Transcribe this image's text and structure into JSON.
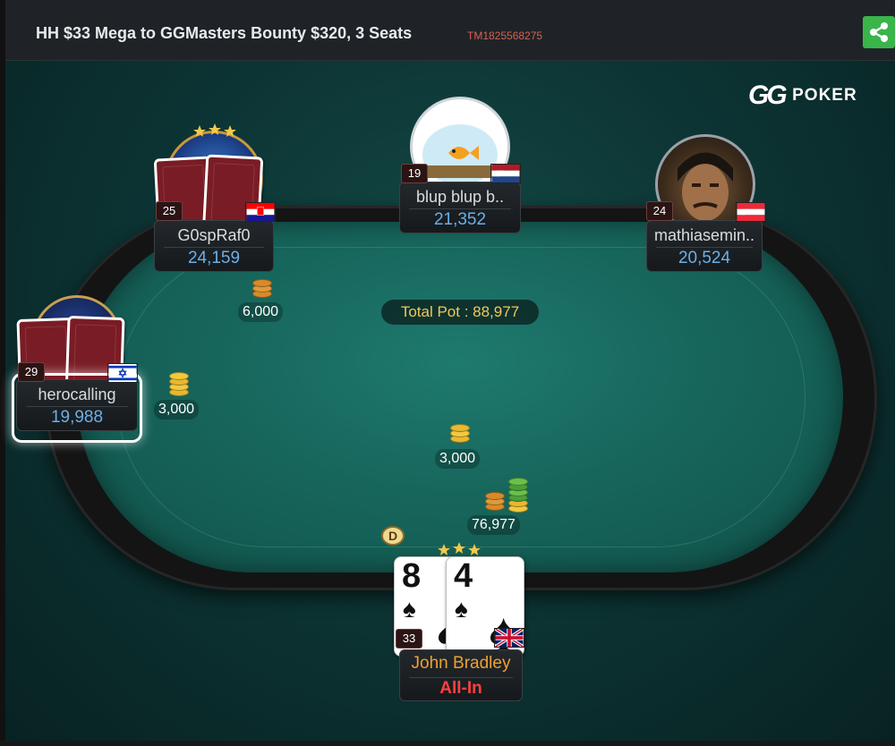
{
  "header": {
    "title": "HH $33 Mega to GGMasters Bounty $320, 3 Seats",
    "tournament_id": "TM1825568275",
    "share_icon": "share-icon"
  },
  "logo": {
    "gg": "GG",
    "poker": "POKER"
  },
  "pot": {
    "label": "Total Pot : 88,977"
  },
  "players": {
    "g0sp": {
      "name": "G0spRaf0",
      "stack": "24,159",
      "level": "25",
      "flag": "croatia",
      "bet": "6,000"
    },
    "blup": {
      "name": "blup blup b..",
      "stack": "21,352",
      "level": "19",
      "flag": "netherlands"
    },
    "mathia": {
      "name": "mathiasemin..",
      "stack": "20,524",
      "level": "24",
      "flag": "austria"
    },
    "hero_calling": {
      "name": "herocalling",
      "stack": "19,988",
      "level": "29",
      "flag": "israel",
      "bet": "3,000"
    },
    "john": {
      "name": "John Bradley",
      "status": "All-In",
      "level": "33",
      "flag": "united-kingdom",
      "cards": [
        {
          "rank": "8",
          "suit": "♠"
        },
        {
          "rank": "4",
          "suit": "♠"
        }
      ]
    }
  },
  "center_bets": {
    "a": "3,000",
    "b": "76,977"
  },
  "dealer_button": "D",
  "colors": {
    "felt": "#17665c",
    "pot_text": "#f1c75a",
    "stack_text": "#6ab0e8",
    "hero_name": "#f0a030",
    "all_in": "#ff4040",
    "share": "#39b54a"
  }
}
